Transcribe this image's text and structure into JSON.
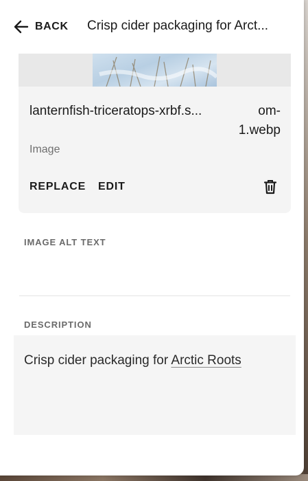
{
  "header": {
    "back_label": "BACK",
    "title": "Crisp cider packaging for Arct..."
  },
  "image": {
    "filename_part1": "lanternfish-triceratops-xrbf.s...",
    "filename_part2": "om-\n1.webp",
    "type_label": "Image",
    "replace_label": "REPLACE",
    "edit_label": "EDIT"
  },
  "alt_text": {
    "label": "IMAGE ALT TEXT",
    "value": ""
  },
  "description": {
    "label": "DESCRIPTION",
    "text_prefix": "Crisp cider packaging for ",
    "link_text": "Arctic Roots"
  },
  "icons": {
    "back": "arrow-left-icon",
    "delete": "trash-icon"
  }
}
